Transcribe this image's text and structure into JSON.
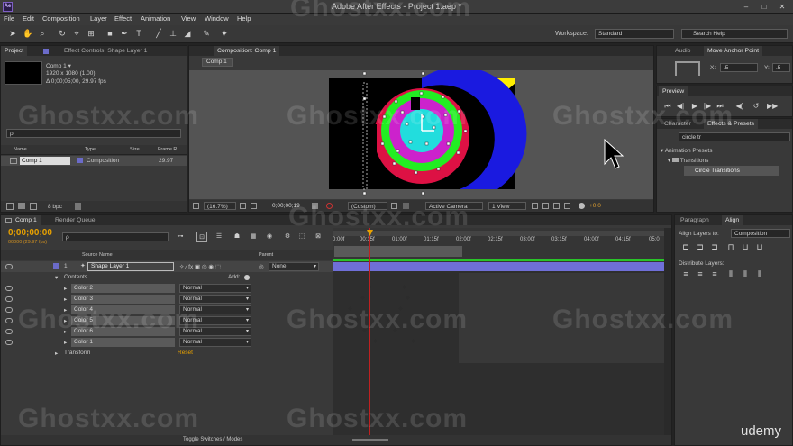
{
  "app": {
    "title": "Adobe After Effects - Project 1.aep *",
    "logo": "Ae",
    "menu": [
      "File",
      "Edit",
      "Composition",
      "Layer",
      "Effect",
      "Animation",
      "View",
      "Window",
      "Help"
    ]
  },
  "toolbar": {
    "workspace_label": "Workspace:",
    "workspace_value": "Standard",
    "search_placeholder": "Search Help"
  },
  "project": {
    "tabs": [
      "Project",
      "Effect Controls: Shape Layer 1"
    ],
    "comp_name": "Comp 1 ▾",
    "comp_res": "1920 x 1080 (1.00)",
    "comp_dur": "Δ 0;00;05;00, 29.97 fps",
    "search_placeholder": "ρ",
    "columns": [
      "Name",
      "Type",
      "Size",
      "Frame R..."
    ],
    "items": [
      {
        "name": "Comp 1",
        "type": "Composition",
        "fps": "29.97"
      }
    ],
    "bpc": "8 bpc"
  },
  "composition": {
    "tab": "Composition: Comp 1",
    "crumb": "Comp 1",
    "zoom": "(16.7%)",
    "timecode": "0;00;00;19",
    "resolution": "(Custom)",
    "camera": "Active Camera",
    "views": "1 View",
    "exposure": "+0.0"
  },
  "right": {
    "tabs_top": [
      "Audio",
      "Move Anchor Point"
    ],
    "x_label": "X:",
    "x_value": ".5",
    "y_label": "Y:",
    "y_value": ".5",
    "preview_tab": "Preview",
    "fx_tabs": [
      "Character",
      "Effects & Presets"
    ],
    "fx_search": "circle tr",
    "tree": [
      "Animation Presets",
      "Transitions",
      "Circle Transitions"
    ],
    "align_tabs": [
      "Paragraph",
      "Align"
    ],
    "align_to_label": "Align Layers to:",
    "align_to_value": "Composition",
    "distribute_label": "Distribute Layers:"
  },
  "timeline": {
    "tabs": [
      "Comp 1",
      "Render Queue"
    ],
    "timecode": "0;00;00;00",
    "fps": "00000 (29.97 fps)",
    "search_placeholder": "ρ",
    "col_source": "Source Name",
    "col_parent": "Parent",
    "layer_num": "1",
    "layer_name": "Shape Layer 1",
    "parent_value": "None",
    "contents_label": "Contents",
    "add_label": "Add:",
    "colors": [
      {
        "name": "Color 2",
        "mode": "Normal"
      },
      {
        "name": "Color 3",
        "mode": "Normal"
      },
      {
        "name": "Color 4",
        "mode": "Normal"
      },
      {
        "name": "Color 5",
        "mode": "Normal"
      },
      {
        "name": "Color 6",
        "mode": "Normal"
      },
      {
        "name": "Color 1",
        "mode": "Normal"
      }
    ],
    "transform_label": "Transform",
    "reset_label": "Reset",
    "ruler": [
      "0:00f",
      "00:15f",
      "01:00f",
      "01:15f",
      "02:00f",
      "02:15f",
      "03:00f",
      "03:15f",
      "04:00f",
      "04:15f",
      "05:0"
    ],
    "toggle_label": "Toggle Switches / Modes"
  },
  "watermarks": [
    "Ghostxx.com",
    "Ghostxx.com",
    "Ghostxx.com",
    "Ghostxx.com",
    "Ghostxx.com",
    "Ghostxx.com",
    "Ghostxx.com",
    "Ghostxx.com",
    "Ghostxx.com",
    "Ghostxx.com"
  ],
  "udemy": "udemy",
  "colors": {
    "accent_orange": "#e8a100",
    "layer_bar": "#6f6fd8",
    "playhead": "#c02020"
  }
}
